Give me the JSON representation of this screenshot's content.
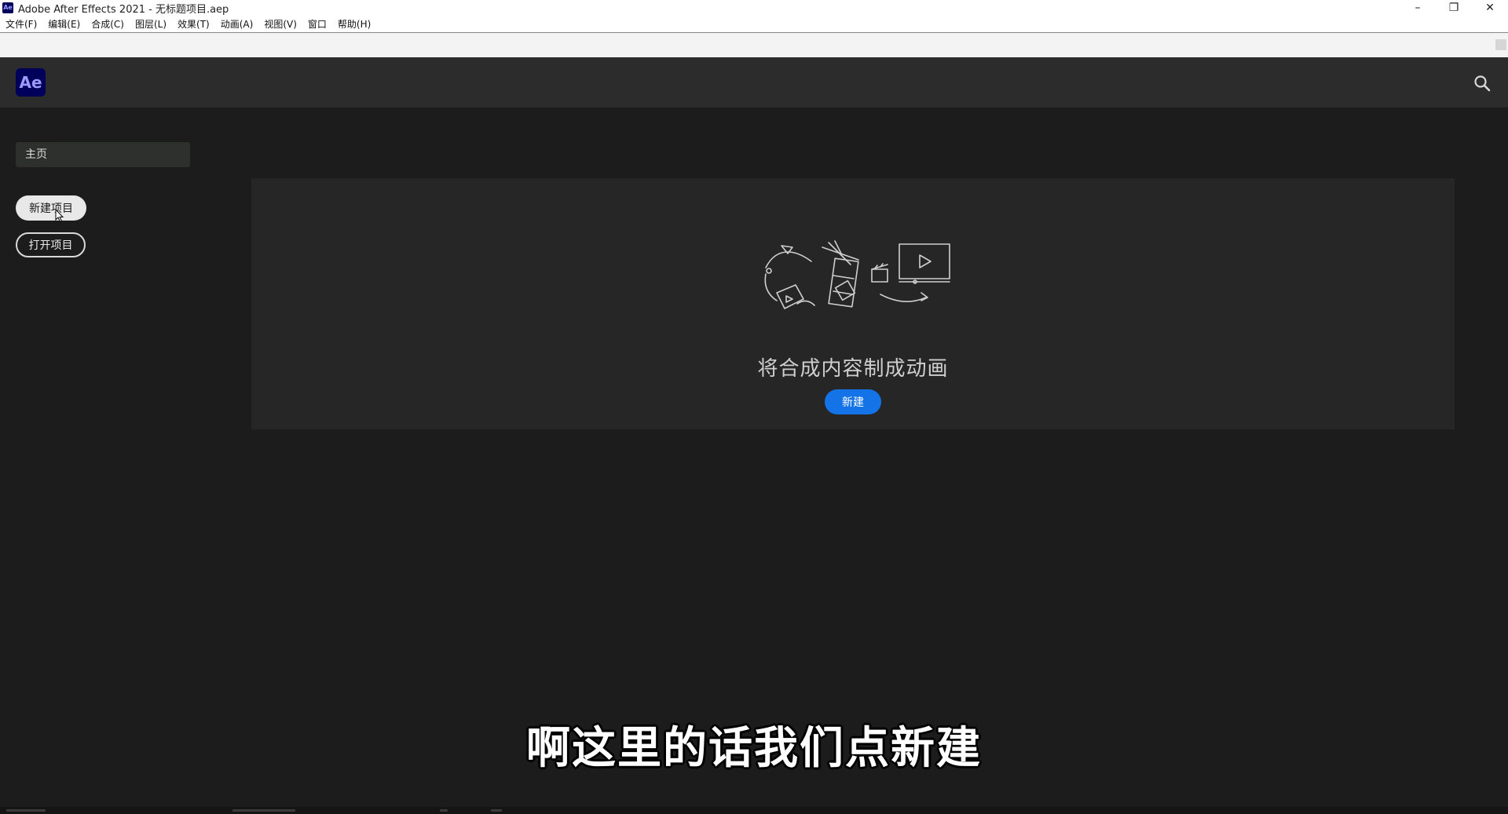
{
  "window": {
    "title": "Adobe After Effects 2021 - 无标题项目.aep",
    "app_icon": "Ae",
    "controls": {
      "minimize": "–",
      "restore": "❐",
      "close": "✕"
    }
  },
  "menubar": {
    "items": [
      "文件(F)",
      "编辑(E)",
      "合成(C)",
      "图层(L)",
      "效果(T)",
      "动画(A)",
      "视图(V)",
      "窗口",
      "帮助(H)"
    ]
  },
  "header": {
    "logo": "Ae",
    "search_icon": "search-icon"
  },
  "nav": {
    "home_label": "主页",
    "new_project_label": "新建项目",
    "open_project_label": "打开项目"
  },
  "card": {
    "illustration_icon": "animation-illustration-icon",
    "heading": "将合成内容制成动画",
    "new_button_label": "新建"
  },
  "subtitle": "啊这里的话我们点新建",
  "colors": {
    "background": "#1b1c1b",
    "header": "#2b2c2b",
    "card": "#252625",
    "accent_blue": "#1473e6",
    "ae_logo_bg": "#00005b",
    "ae_logo_text": "#9a9aff"
  }
}
